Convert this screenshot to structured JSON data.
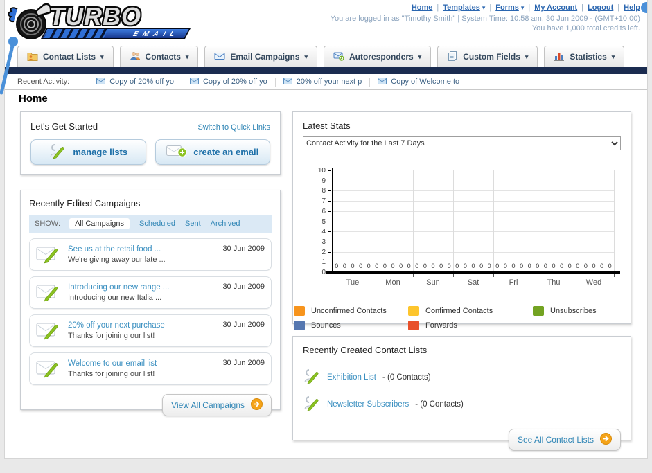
{
  "brand": {
    "title": "TURBO",
    "subtitle": "EMAIL"
  },
  "header": {
    "nav_links": [
      {
        "label": "Home",
        "dropdown": false
      },
      {
        "label": "Templates",
        "dropdown": true
      },
      {
        "label": "Forms",
        "dropdown": true
      },
      {
        "label": "My Account",
        "dropdown": false
      },
      {
        "label": "Logout",
        "dropdown": false
      },
      {
        "label": "Help",
        "dropdown": false
      }
    ],
    "session_line": "You are logged in as \"Timothy Smith\" | System Time: 10:58 am, 30 Jun 2009 - (GMT+10:00)",
    "credits_line": "You have 1,000 total credits left."
  },
  "tabs": [
    {
      "label": "Contact Lists",
      "icon": "contact-lists-icon"
    },
    {
      "label": "Contacts",
      "icon": "contacts-icon"
    },
    {
      "label": "Email Campaigns",
      "icon": "email-campaigns-icon"
    },
    {
      "label": "Autoresponders",
      "icon": "autoresponders-icon"
    },
    {
      "label": "Custom Fields",
      "icon": "custom-fields-icon"
    },
    {
      "label": "Statistics",
      "icon": "statistics-icon"
    }
  ],
  "recent_activity": {
    "label": "Recent Activity:",
    "items": [
      "Copy of 20% off yo",
      "Copy of 20% off yo",
      "20% off your next p",
      "Copy of Welcome to"
    ]
  },
  "page_title": "Home",
  "get_started": {
    "title": "Let's Get Started",
    "switch_link": "Switch to Quick Links",
    "buttons": [
      {
        "label": "manage lists",
        "icon": "person-pencil-icon"
      },
      {
        "label": "create an email",
        "icon": "envelope-plus-icon"
      }
    ]
  },
  "campaigns": {
    "title": "Recently Edited Campaigns",
    "show_label": "SHOW:",
    "filters": [
      "All Campaigns",
      "Scheduled",
      "Sent",
      "Archived"
    ],
    "active_filter": "All Campaigns",
    "items": [
      {
        "title": "See us at the retail food ...",
        "subtitle": "We're giving away our late ...",
        "date": "30 Jun 2009"
      },
      {
        "title": "Introducing our new range ...",
        "subtitle": "Introducing our new Italia ...",
        "date": "30 Jun 2009"
      },
      {
        "title": "20% off your next purchase",
        "subtitle": "Thanks for joining our list!",
        "date": "30 Jun 2009"
      },
      {
        "title": "Welcome to our email list",
        "subtitle": "Thanks for joining our list!",
        "date": "30 Jun 2009"
      }
    ],
    "view_all_label": "View All Campaigns"
  },
  "latest_stats": {
    "title": "Latest Stats",
    "selector_value": "Contact Activity for the Last 7 Days"
  },
  "chart_data": {
    "type": "bar",
    "title": "Contact Activity for the Last 7 Days",
    "categories": [
      "Tue",
      "Mon",
      "Sun",
      "Sat",
      "Fri",
      "Thu",
      "Wed"
    ],
    "series": [
      {
        "name": "Unconfirmed Contacts",
        "color": "#f7941d",
        "values": [
          0,
          0,
          0,
          0,
          0,
          0,
          0
        ]
      },
      {
        "name": "Confirmed Contacts",
        "color": "#fdc52d",
        "values": [
          0,
          0,
          0,
          0,
          0,
          0,
          0
        ]
      },
      {
        "name": "Unsubscribes",
        "color": "#73a322",
        "values": [
          0,
          0,
          0,
          0,
          0,
          0,
          0
        ]
      },
      {
        "name": "Bounces",
        "color": "#5577b0",
        "values": [
          0,
          0,
          0,
          0,
          0,
          0,
          0
        ]
      },
      {
        "name": "Forwards",
        "color": "#e8502a",
        "values": [
          0,
          0,
          0,
          0,
          0,
          0,
          0
        ]
      }
    ],
    "ylim": [
      0,
      10
    ],
    "yticks": [
      0,
      1,
      2,
      3,
      4,
      5,
      6,
      7,
      8,
      9,
      10
    ],
    "grid": true,
    "legend_position": "bottom",
    "xlabel": "",
    "ylabel": ""
  },
  "contact_lists": {
    "title": "Recently Created Contact Lists",
    "items": [
      {
        "name": "Exhibition List",
        "suffix": " - (0 Contacts)"
      },
      {
        "name": "Newsletter Subscribers",
        "suffix": " - (0 Contacts)"
      }
    ],
    "see_all_label": "See All Contact Lists"
  }
}
